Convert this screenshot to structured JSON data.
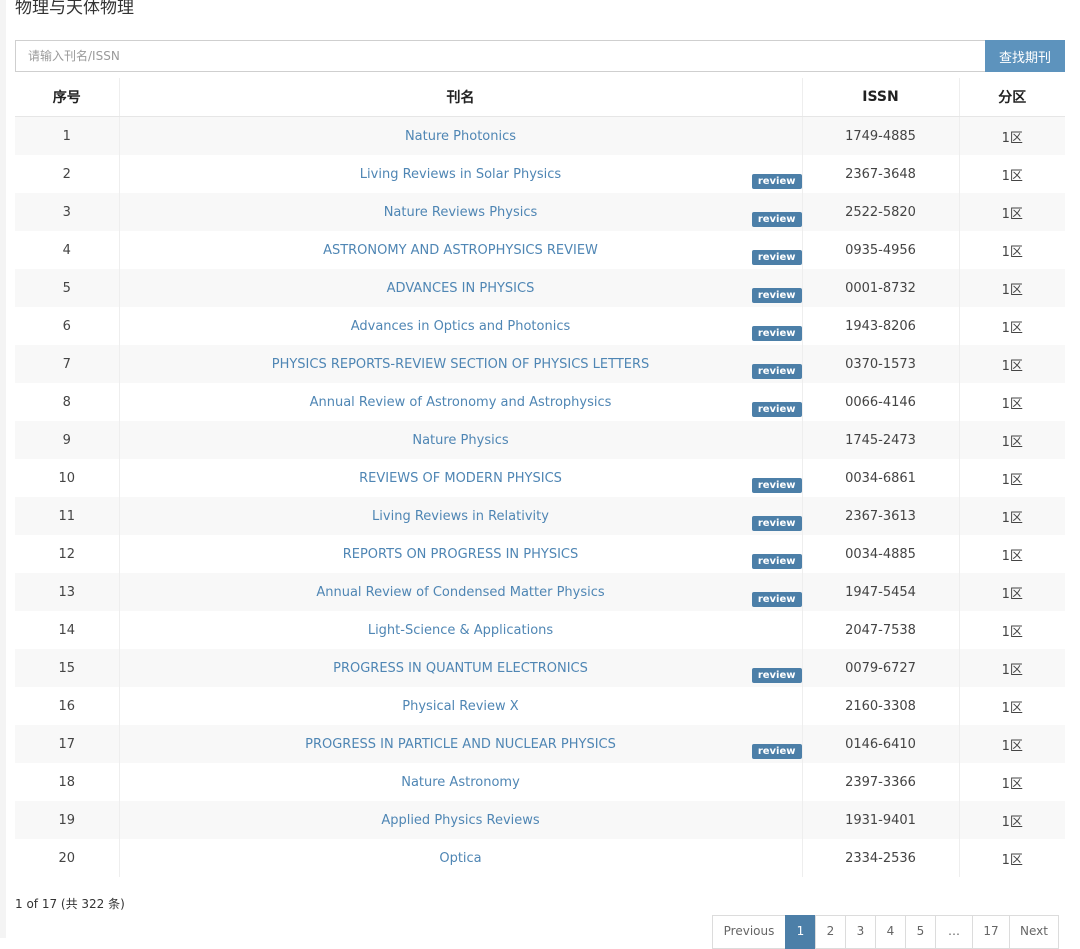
{
  "section": {
    "title": "物理与天体物理"
  },
  "search": {
    "placeholder": "请输入刊名/ISSN",
    "button_label": "查找期刊"
  },
  "table": {
    "headers": [
      "序号",
      "刊名",
      "ISSN",
      "分区"
    ],
    "rows": [
      {
        "index": "1",
        "name": "Nature Photonics",
        "issn": "1749-4885",
        "zone": "1区",
        "review": false
      },
      {
        "index": "2",
        "name": "Living Reviews in Solar Physics",
        "issn": "2367-3648",
        "zone": "1区",
        "review": true
      },
      {
        "index": "3",
        "name": "Nature Reviews Physics",
        "issn": "2522-5820",
        "zone": "1区",
        "review": true
      },
      {
        "index": "4",
        "name": "ASTRONOMY AND ASTROPHYSICS REVIEW",
        "issn": "0935-4956",
        "zone": "1区",
        "review": true
      },
      {
        "index": "5",
        "name": "ADVANCES IN PHYSICS",
        "issn": "0001-8732",
        "zone": "1区",
        "review": true
      },
      {
        "index": "6",
        "name": "Advances in Optics and Photonics",
        "issn": "1943-8206",
        "zone": "1区",
        "review": true
      },
      {
        "index": "7",
        "name": "PHYSICS REPORTS-REVIEW SECTION OF PHYSICS LETTERS",
        "issn": "0370-1573",
        "zone": "1区",
        "review": true
      },
      {
        "index": "8",
        "name": "Annual Review of Astronomy and Astrophysics",
        "issn": "0066-4146",
        "zone": "1区",
        "review": true
      },
      {
        "index": "9",
        "name": "Nature Physics",
        "issn": "1745-2473",
        "zone": "1区",
        "review": false
      },
      {
        "index": "10",
        "name": "REVIEWS OF MODERN PHYSICS",
        "issn": "0034-6861",
        "zone": "1区",
        "review": true
      },
      {
        "index": "11",
        "name": "Living Reviews in Relativity",
        "issn": "2367-3613",
        "zone": "1区",
        "review": true
      },
      {
        "index": "12",
        "name": "REPORTS ON PROGRESS IN PHYSICS",
        "issn": "0034-4885",
        "zone": "1区",
        "review": true
      },
      {
        "index": "13",
        "name": "Annual Review of Condensed Matter Physics",
        "issn": "1947-5454",
        "zone": "1区",
        "review": true
      },
      {
        "index": "14",
        "name": "Light-Science & Applications",
        "issn": "2047-7538",
        "zone": "1区",
        "review": false
      },
      {
        "index": "15",
        "name": "PROGRESS IN QUANTUM ELECTRONICS",
        "issn": "0079-6727",
        "zone": "1区",
        "review": true
      },
      {
        "index": "16",
        "name": "Physical Review X",
        "issn": "2160-3308",
        "zone": "1区",
        "review": false
      },
      {
        "index": "17",
        "name": "PROGRESS IN PARTICLE AND NUCLEAR PHYSICS",
        "issn": "0146-6410",
        "zone": "1区",
        "review": true
      },
      {
        "index": "18",
        "name": "Nature Astronomy",
        "issn": "2397-3366",
        "zone": "1区",
        "review": false
      },
      {
        "index": "19",
        "name": "Applied Physics Reviews",
        "issn": "1931-9401",
        "zone": "1区",
        "review": false
      },
      {
        "index": "20",
        "name": "Optica",
        "issn": "2334-2536",
        "zone": "1区",
        "review": false
      }
    ],
    "review_label": "review"
  },
  "summary": "1 of 17 (共 322 条)",
  "pagination": {
    "previous": "Previous",
    "pages": [
      "1",
      "2",
      "3",
      "4",
      "5",
      "…",
      "17"
    ],
    "current": "1",
    "next": "Next"
  },
  "colors": {
    "accent": "#4c7fa8",
    "link": "#4f86b4",
    "search_button": "#5d93bd"
  }
}
